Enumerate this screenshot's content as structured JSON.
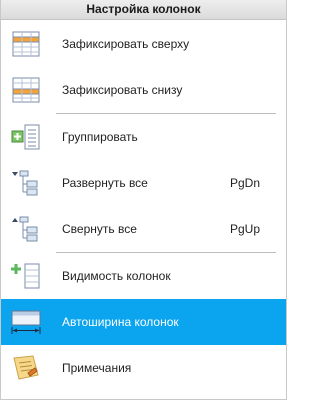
{
  "menu": {
    "header": "Настройка колонок",
    "items": [
      {
        "label": "Зафиксировать сверху",
        "shortcut": "",
        "icon": "pin-top-icon"
      },
      {
        "label": "Зафиксировать снизу",
        "shortcut": "",
        "icon": "pin-bottom-icon"
      },
      {
        "label": "Группировать",
        "shortcut": "",
        "icon": "group-icon"
      },
      {
        "label": "Развернуть все",
        "shortcut": "PgDn",
        "icon": "expand-all-icon"
      },
      {
        "label": "Свернуть все",
        "shortcut": "PgUp",
        "icon": "collapse-all-icon"
      },
      {
        "label": "Видимость колонок",
        "shortcut": "",
        "icon": "column-visibility-icon"
      },
      {
        "label": "Автоширина колонок",
        "shortcut": "",
        "icon": "auto-width-icon",
        "selected": true
      },
      {
        "label": "Примечания",
        "shortcut": "",
        "icon": "notes-icon"
      }
    ]
  },
  "colors": {
    "selected_bg": "#0aa4ef",
    "accent_orange": "#f0a030",
    "accent_green": "#5cb85c"
  }
}
